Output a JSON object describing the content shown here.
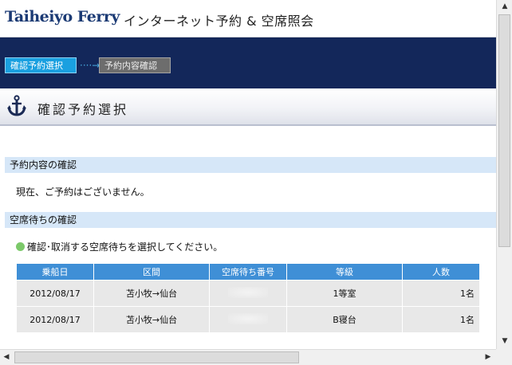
{
  "header": {
    "logo": "Taiheiyo Ferry",
    "title": "インターネット予約 & 空席照会"
  },
  "steps": {
    "current": "確認予約選択",
    "arrow": "····→",
    "next": "予約内容確認"
  },
  "page": {
    "title": "確認予約選択"
  },
  "section1": {
    "heading": "予約内容の確認",
    "text": "現在、ご予約はございません。"
  },
  "section2": {
    "heading": "空席待ちの確認",
    "instruction": "確認･取消する空席待ちを選択してください。"
  },
  "table": {
    "headers": [
      "乗船日",
      "区間",
      "空席待ち番号",
      "等級",
      "人数"
    ],
    "rows": [
      {
        "date": "2012/08/17",
        "route": "苫小牧→仙台",
        "number": "",
        "grade": "1等室",
        "count": "1名"
      },
      {
        "date": "2012/08/17",
        "route": "苫小牧→仙台",
        "number": "",
        "grade": "B寝台",
        "count": "1名"
      }
    ]
  },
  "colors": {
    "nav_band": "#13275a",
    "step_active": "#1aa0e0",
    "step_inactive": "#6d6d6d",
    "section_head": "#d6e7f8",
    "table_header": "#3f8fd6",
    "bullet": "#7cc96a"
  },
  "icons": {
    "page": "anchor-icon",
    "bullet": "green-dot-icon"
  }
}
